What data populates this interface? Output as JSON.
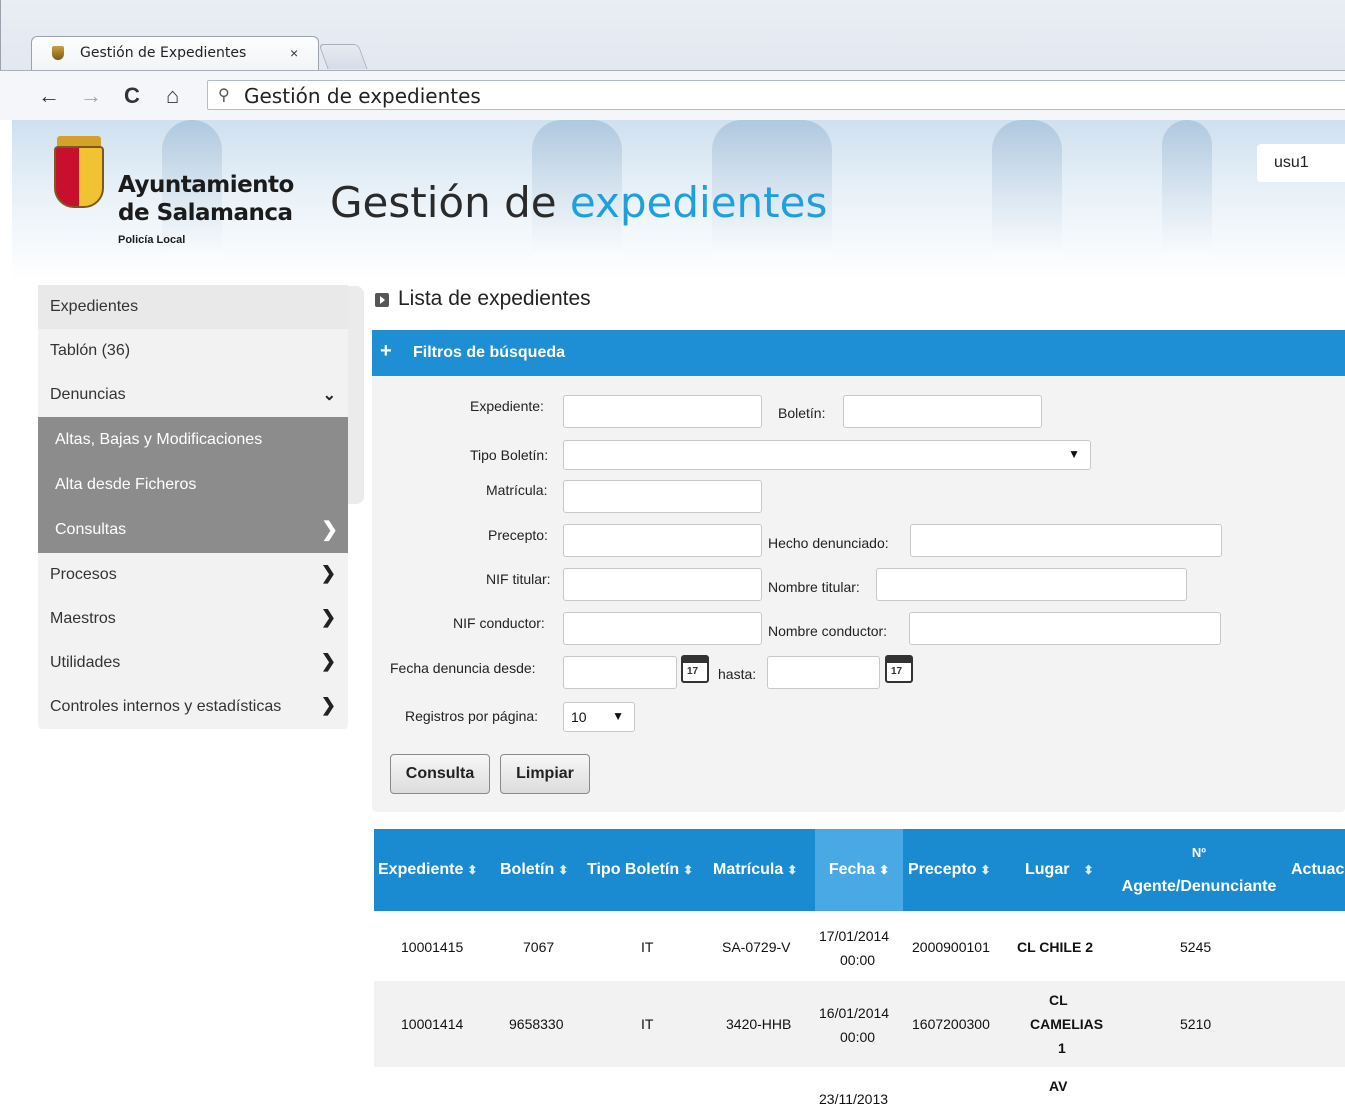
{
  "browser": {
    "tab_title": "Gestión de Expedientes",
    "tab_close": "×",
    "address": "Gestión de expedientes",
    "back": "←",
    "forward": "→",
    "reload": "C",
    "home": "⌂",
    "search_glyph": "⚲"
  },
  "header": {
    "org_line1": "Ayuntamiento",
    "org_line2": "de Salamanca",
    "org_line3": "Policía Local",
    "title_prefix": "Gestión de ",
    "title_accent": "expedientes",
    "accent_color": "#1fa0dc",
    "user": "usu1"
  },
  "sidebar": {
    "items": [
      {
        "label": "Expedientes"
      },
      {
        "label": "Tablón (36)"
      },
      {
        "label": "Denuncias",
        "chev": "❯"
      },
      {
        "label": "Procesos",
        "chev": "❯"
      },
      {
        "label": "Maestros",
        "chev": "❯"
      },
      {
        "label": "Utilidades",
        "chev": "❯"
      },
      {
        "label": "Controles internos y estadísticas",
        "chev": "❯"
      }
    ],
    "denuncias_chev": "✔",
    "submenu": [
      {
        "label": "Altas, Bajas y Modificaciones"
      },
      {
        "label": "Alta desde Ficheros"
      },
      {
        "label": "Consultas",
        "chev": "❯"
      }
    ]
  },
  "main": {
    "title": "Lista de expedientes",
    "filters_title": "Filtros de búsqueda",
    "filters_plus": "+"
  },
  "filters": {
    "expediente": "Expediente:",
    "boletin": "Boletín:",
    "tipo_boletin": "Tipo Boletín:",
    "matricula": "Matrícula:",
    "precepto": "Precepto:",
    "hecho_denunciado": "Hecho denunciado:",
    "nif_titular": "NIF titular:",
    "nombre_titular": "Nombre titular:",
    "nif_conductor": "NIF conductor:",
    "nombre_conductor": "Nombre conductor:",
    "fecha_desde": "Fecha denuncia desde:",
    "hasta": "hasta:",
    "registros": "Registros por página:",
    "registros_value": "10",
    "select_arrow": "▼",
    "cal_day": "17",
    "btn_consulta": "Consulta",
    "btn_limpiar": "Limpiar"
  },
  "table": {
    "headers": {
      "expediente": "Expediente",
      "boletin": "Boletín",
      "tipo": "Tipo Boletín",
      "matricula": "Matrícula",
      "fecha": "Fecha",
      "precepto": "Precepto",
      "lugar": "Lugar",
      "agente_1": "Nº",
      "agente_2": "Agente/Denunciante",
      "actuac": "Actuac",
      "sort": "⬍",
      "sort_active": "⬍"
    },
    "rows": [
      {
        "expediente": "10001415",
        "boletin": "7067",
        "tipo": "IT",
        "matricula": "SA-0729-V",
        "fecha_1": "17/01/2014",
        "fecha_2": "00:00",
        "precepto": "2000900101",
        "lugar_1": "CL CHILE 2",
        "lugar_2": "",
        "lugar_3": "",
        "agente": "5245"
      },
      {
        "expediente": "10001414",
        "boletin": "9658330",
        "tipo": "IT",
        "matricula": "3420-HHB",
        "fecha_1": "16/01/2014",
        "fecha_2": "00:00",
        "precepto": "1607200300",
        "lugar_1": "CL",
        "lugar_2": "CAMELIAS",
        "lugar_3": "1",
        "agente": "5210"
      },
      {
        "expediente": "",
        "boletin": "",
        "tipo": "",
        "matricula": "",
        "fecha_1": "23/11/2013",
        "fecha_2": "",
        "precepto": "",
        "lugar_1": "AV",
        "lugar_2": "",
        "lugar_3": "",
        "agente": ""
      }
    ]
  }
}
